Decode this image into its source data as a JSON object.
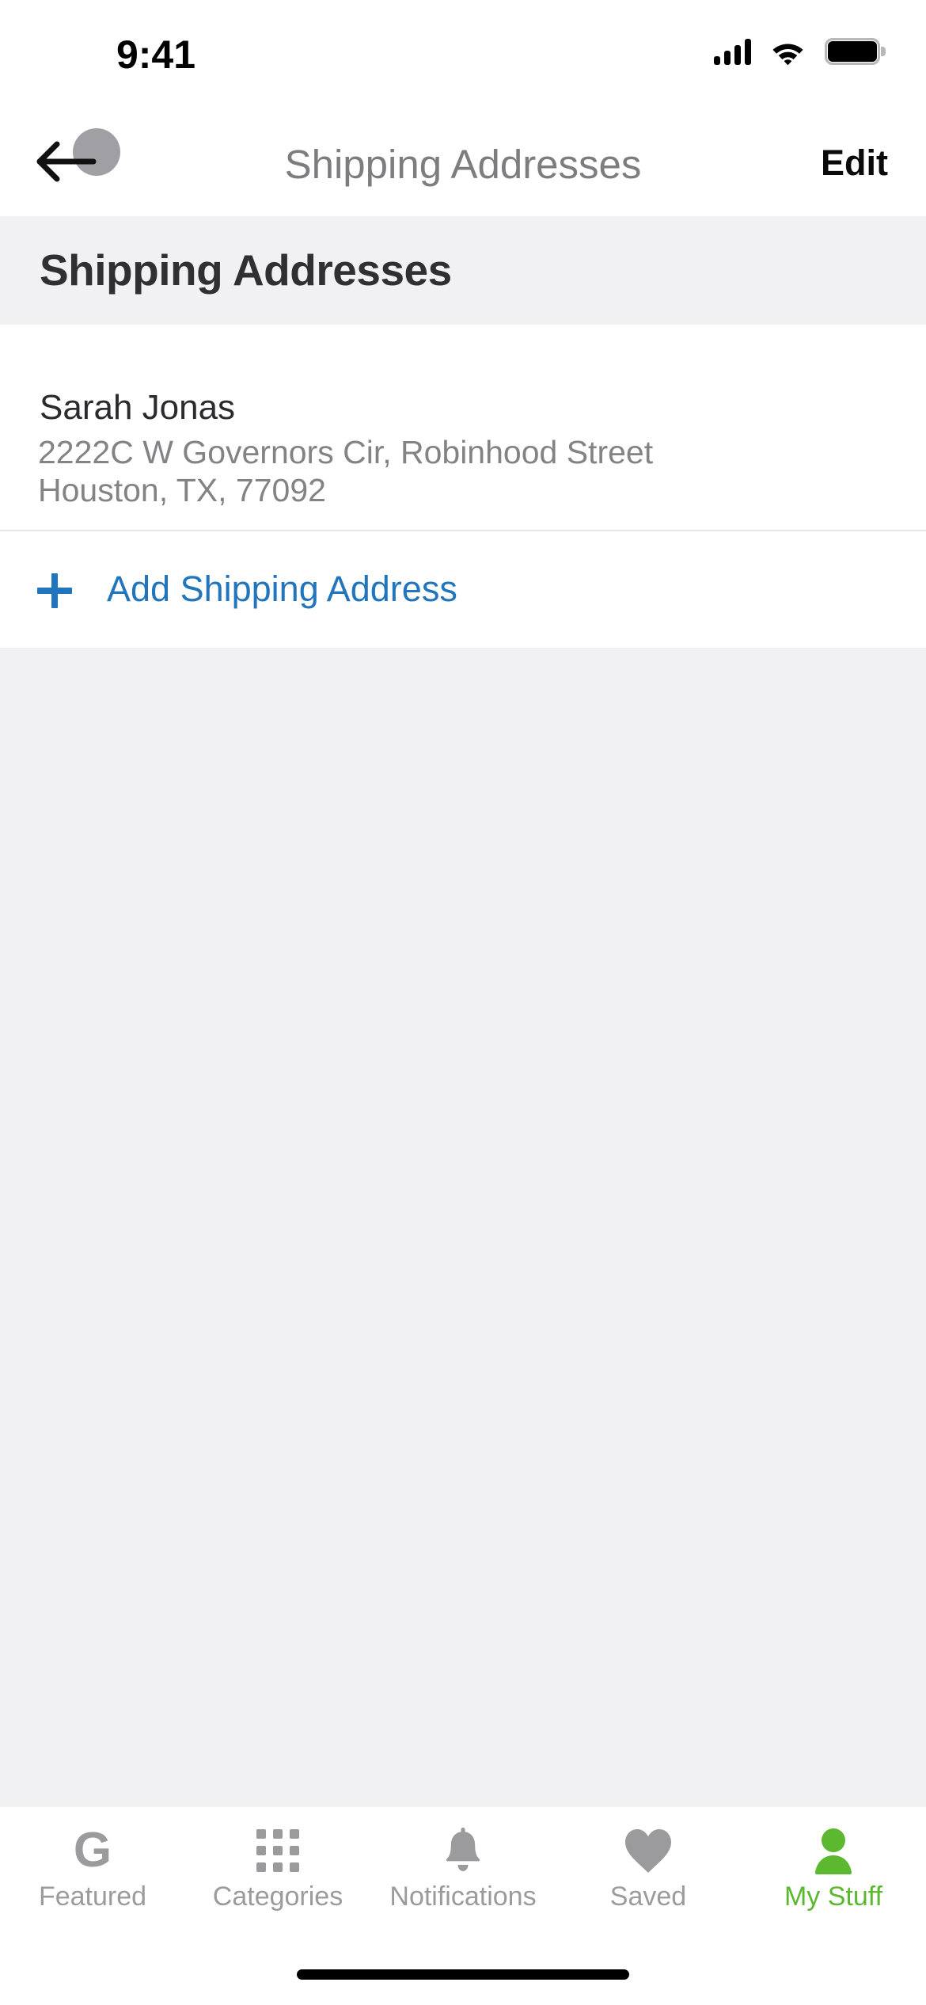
{
  "status_bar": {
    "time": "9:41",
    "signal_icon": "cellular-signal-icon",
    "wifi_icon": "wifi-icon",
    "battery_icon": "battery-full-icon"
  },
  "nav_bar": {
    "back_icon": "back-arrow-icon",
    "title": "Shipping Addresses",
    "edit_label": "Edit",
    "cursor_indicator": "touch-cursor-dot"
  },
  "header": {
    "title": "Shipping Addresses"
  },
  "addresses": [
    {
      "name": "Sarah Jonas",
      "line1": "2222C W Governors Cir, Robinhood Street",
      "line2": "Houston, TX, 77092"
    }
  ],
  "add_address": {
    "icon": "plus-icon",
    "label": "Add Shipping Address"
  },
  "tab_bar": {
    "tabs": [
      {
        "label": "Featured",
        "icon": "letter-g-icon",
        "active": false
      },
      {
        "label": "Categories",
        "icon": "grid-icon",
        "active": false
      },
      {
        "label": "Notifications",
        "icon": "bell-icon",
        "active": false
      },
      {
        "label": "Saved",
        "icon": "heart-icon",
        "active": false
      },
      {
        "label": "My Stuff",
        "icon": "person-icon",
        "active": true
      }
    ]
  },
  "colors": {
    "accent_blue": "#2175bc",
    "active_green": "#5cb82e",
    "inactive_gray": "#9b9b9e",
    "band_gray": "#f1f0f2",
    "text_dark": "#2b2b2e",
    "text_muted": "#838386",
    "nav_title_gray": "#7d7d80"
  },
  "home_indicator": "home-indicator-bar"
}
